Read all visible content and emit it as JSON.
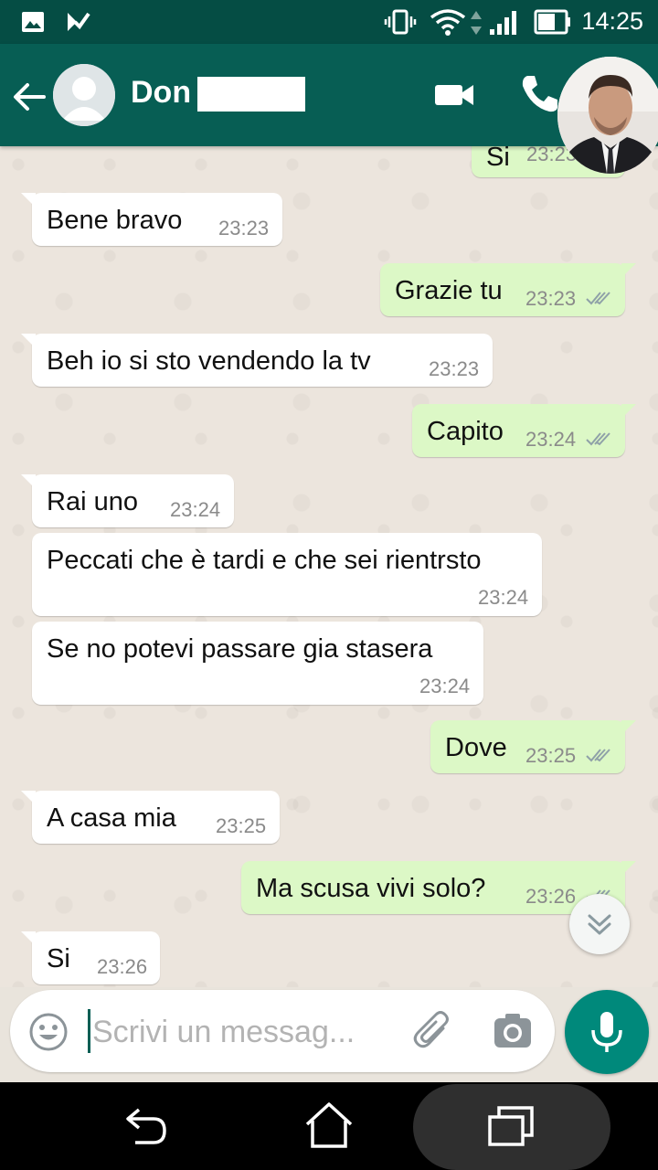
{
  "status_bar": {
    "time": "14:25"
  },
  "header": {
    "contact_name": "Don"
  },
  "messages": [
    {
      "dir": "out",
      "text": "Si",
      "time": "23:23"
    },
    {
      "dir": "in",
      "text": "Bene bravo",
      "time": "23:23"
    },
    {
      "dir": "out",
      "text": "Grazie tu",
      "time": "23:23"
    },
    {
      "dir": "in",
      "text": "Beh io si sto vendendo la tv",
      "time": "23:23"
    },
    {
      "dir": "out",
      "text": "Capito",
      "time": "23:24"
    },
    {
      "dir": "in",
      "text": "Rai uno",
      "time": "23:24"
    },
    {
      "dir": "in",
      "text": "Peccati che è tardi e che sei rientrsto",
      "time": "23:24"
    },
    {
      "dir": "in",
      "text": "Se no potevi passare gia stasera",
      "time": "23:24"
    },
    {
      "dir": "out",
      "text": "Dove",
      "time": "23:25"
    },
    {
      "dir": "in",
      "text": "A casa mia",
      "time": "23:25"
    },
    {
      "dir": "out",
      "text": "Ma scusa vivi solo?",
      "time": "23:26"
    },
    {
      "dir": "in",
      "text": "Si",
      "time": "23:26"
    }
  ],
  "composer": {
    "placeholder": "Scrivi un messag..."
  },
  "colors": {
    "header": "#075e54",
    "status_bar": "#054d44",
    "outgoing_bubble": "#dcf8c6",
    "incoming_bubble": "#ffffff",
    "mic_button": "#00897b",
    "read_ticks": "#8fa1a8"
  }
}
